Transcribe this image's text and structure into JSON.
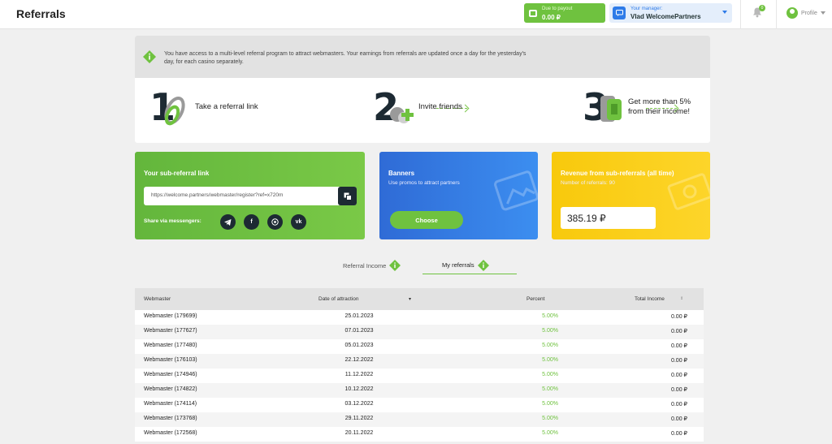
{
  "header": {
    "title": "Referrals",
    "payout_label": "Due to payout",
    "payout_value": "0.00 ₽",
    "manager_label": "Your manager:",
    "manager_name": "Vlad WelcomePartners",
    "notif_count": "0",
    "profile_label": "Profile"
  },
  "info": {
    "text": "You have access to a multi-level referral program to attract webmasters. Your earnings from referrals are updated once a day for the yesterday's day, for each casino separately.",
    "steps": [
      {
        "num": "1",
        "text": "Take a referral link"
      },
      {
        "num": "2",
        "text": "Invite friends"
      },
      {
        "num": "3",
        "text1": "Get more than 5%",
        "text2": "from their income!"
      }
    ]
  },
  "sub_referral": {
    "title": "Your sub-referral link",
    "url": "https://welcome.partners/webmaster/register?ref=x720m",
    "share_label": "Share via messengers:",
    "socials": [
      "telegram-icon",
      "facebook-icon",
      "whatsapp-icon",
      "vk-icon"
    ]
  },
  "banners": {
    "title": "Banners",
    "subtitle": "Use promos to attract partners",
    "button": "Choose"
  },
  "revenue": {
    "title": "Revenue from sub-referrals (all time)",
    "subtitle": "Number of referrals: 90",
    "value": "385.19 ₽"
  },
  "tabs": [
    {
      "label": "Referral Income"
    },
    {
      "label": "My referrals"
    }
  ],
  "table": {
    "headers": [
      "Webmaster",
      "Date of attraction",
      "Percent",
      "Total Income"
    ],
    "rows": [
      [
        "Webmaster (179699)",
        "25.01.2023",
        "5.00%",
        "0.00 ₽"
      ],
      [
        "Webmaster (177627)",
        "07.01.2023",
        "5.00%",
        "0.00 ₽"
      ],
      [
        "Webmaster (177480)",
        "05.01.2023",
        "5.00%",
        "0.00 ₽"
      ],
      [
        "Webmaster (176103)",
        "22.12.2022",
        "5.00%",
        "0.00 ₽"
      ],
      [
        "Webmaster (174946)",
        "11.12.2022",
        "5.00%",
        "0.00 ₽"
      ],
      [
        "Webmaster (174822)",
        "10.12.2022",
        "5.00%",
        "0.00 ₽"
      ],
      [
        "Webmaster (174114)",
        "03.12.2022",
        "5.00%",
        "0.00 ₽"
      ],
      [
        "Webmaster (173768)",
        "29.11.2022",
        "5.00%",
        "0.00 ₽"
      ],
      [
        "Webmaster (172568)",
        "20.11.2022",
        "5.00%",
        "0.00 ₽"
      ]
    ]
  },
  "colors": {
    "accent_green": "#6fc23f",
    "banner_blue": "#2f6bd6",
    "revenue_yellow": "#f8c90c",
    "dark": "#1d2a33"
  }
}
